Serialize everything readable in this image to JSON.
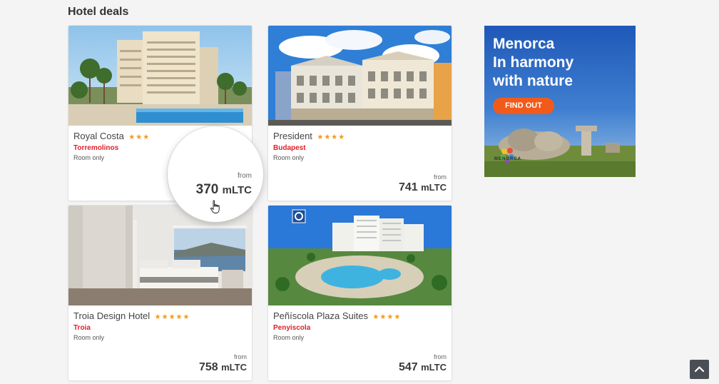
{
  "section": {
    "title": "Hotel deals"
  },
  "hotels": [
    {
      "name": "Royal Costa",
      "stars": "★★★",
      "city": "Torremolinos",
      "board": "Room only",
      "from_label": "from",
      "price": "370",
      "unit": "mLTC"
    },
    {
      "name": "President",
      "stars": "★★★★",
      "city": "Budapest",
      "board": "Room only",
      "from_label": "from",
      "price": "741",
      "unit": "mLTC"
    },
    {
      "name": "Troia Design Hotel",
      "stars": "★★★★★",
      "city": "Troia",
      "board": "Room only",
      "from_label": "from",
      "price": "758",
      "unit": "mLTC"
    },
    {
      "name": "Peñíscola Plaza Suites",
      "stars": "★★★★",
      "city": "Penyiscola",
      "board": "Room only",
      "from_label": "from",
      "price": "547",
      "unit": "mLTC"
    }
  ],
  "ad": {
    "line1": "Menorca",
    "line2": "In harmony",
    "line3": "with nature",
    "button": "FIND OUT",
    "logo": "MENORCA"
  },
  "colors": {
    "accent": "#e01f26",
    "stars": "#f29a1f",
    "ad_button": "#f25a1a",
    "background": "#f4f4f4"
  },
  "icons": {
    "scroll_top": "chevron-up-icon",
    "cursor": "hand-pointer-icon"
  }
}
